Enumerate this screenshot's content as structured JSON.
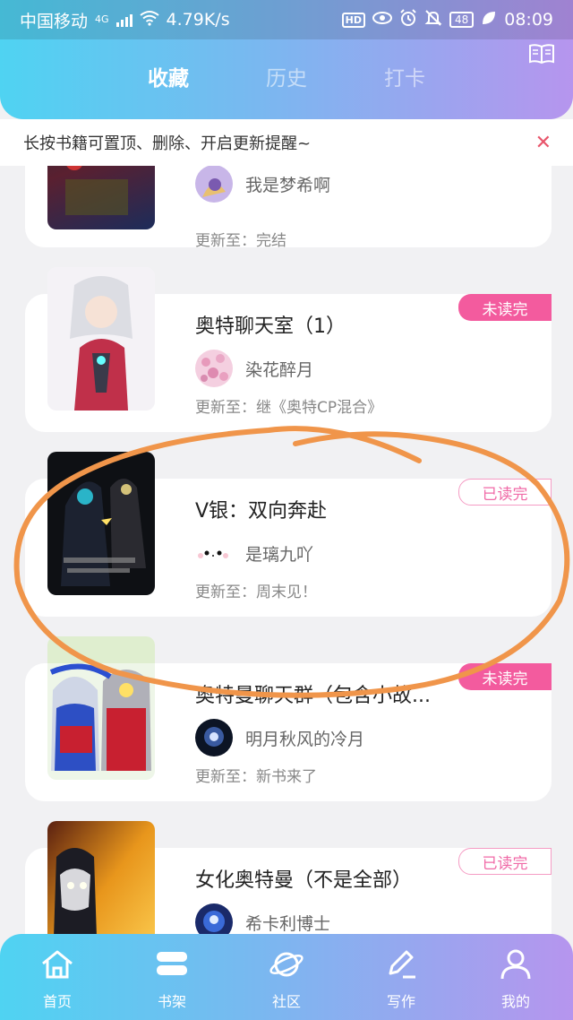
{
  "status_bar": {
    "carrier": "中国移动",
    "network_type": "4G",
    "speed": "4.79K/s",
    "hd": "HD",
    "battery": "48",
    "time": "08:09"
  },
  "tabs": [
    {
      "label": "收藏",
      "active": true
    },
    {
      "label": "历史",
      "active": false
    },
    {
      "label": "打卡",
      "active": false
    }
  ],
  "notice": {
    "text": "长按书籍可置顶、删除、开启更新提醒~"
  },
  "books": [
    {
      "title": "",
      "author": "我是梦希啊",
      "update": "更新至：完结",
      "badge": ""
    },
    {
      "title": "奥特聊天室（1）",
      "author": "染花醉月",
      "update": "更新至：继《奥特CP混合》",
      "badge": "未读完",
      "badge_type": "unread"
    },
    {
      "title": "V银：双向奔赴",
      "author": "是璃九吖",
      "update": "更新至：周末见！",
      "badge": "已读完",
      "badge_type": "read"
    },
    {
      "title": "奥特曼聊天群（包含小故...",
      "author": "明月秋风的冷月",
      "update": "更新至：新书来了",
      "badge": "未读完",
      "badge_type": "unread"
    },
    {
      "title": "女化奥特曼（不是全部）",
      "author": "希卡利博士",
      "update": "",
      "badge": "已读完",
      "badge_type": "read"
    }
  ],
  "bottom_nav": [
    {
      "label": "首页",
      "icon": "home-icon"
    },
    {
      "label": "书架",
      "icon": "bookshelf-icon"
    },
    {
      "label": "社区",
      "icon": "planet-icon"
    },
    {
      "label": "写作",
      "icon": "pen-icon"
    },
    {
      "label": "我的",
      "icon": "user-icon"
    }
  ],
  "colors": {
    "gradient_start": "#4fd3f2",
    "gradient_end": "#b695ee",
    "unread_badge": "#f35b9e",
    "read_badge_text": "#f06aa7",
    "annotation_circle": "#f0954a"
  }
}
